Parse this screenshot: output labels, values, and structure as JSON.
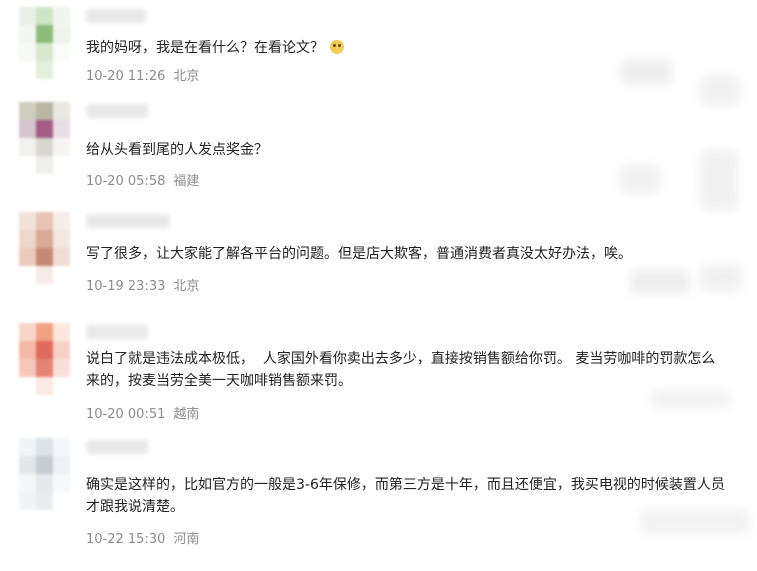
{
  "comments": [
    {
      "text": "我的妈呀，我是在看什么？在看论文？",
      "date": "10-20 11:26",
      "location": "北京",
      "emoji": "face-emoji"
    },
    {
      "text": "给从头看到尾的人发点奖金？",
      "date": "10-20 05:58",
      "location": "福建"
    },
    {
      "text": "写了很多，让大家能了解各平台的问题。但是店大欺客，普通消费者真没太好办法，唉。",
      "date": "10-19 23:33",
      "location": "北京"
    },
    {
      "text": "说白了就是违法成本极低，  人家国外看你卖出去多少，直接按销售额给你罚。 麦当劳咖啡的罚款怎么来的，按麦当劳全美一天咖啡销售额来罚。",
      "date": "10-20 00:51",
      "location": "越南"
    },
    {
      "text": "确实是这样的，比如官方的一般是3-6年保修，而第三方是十年，而且还便宜，我买电视的时候装置人员才跟我说清楚。",
      "date": "10-22 15:30",
      "location": "河南"
    }
  ],
  "colors": {
    "text": "#222222",
    "meta": "#8c8c8c",
    "avatar1": [
      "#8dbb7c",
      "#cfe3c6"
    ],
    "avatar2": [
      "#b9b6a6",
      "#a45c86"
    ],
    "avatar3": [
      "#e7c4b6",
      "#c48a76"
    ],
    "avatar4": [
      "#f0a184",
      "#e06a5e"
    ],
    "avatar5": [
      "#dbe4ea",
      "#c5ccd3"
    ]
  }
}
